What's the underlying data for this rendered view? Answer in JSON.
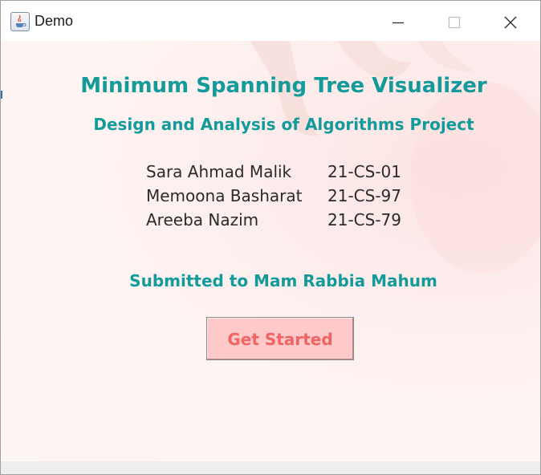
{
  "window": {
    "title": "Demo",
    "controls": [
      "minimize-icon",
      "maximize-icon",
      "close-icon"
    ]
  },
  "main": {
    "title": "Minimum Spanning Tree Visualizer",
    "subtitle": "Design and Analysis of Algorithms Project",
    "members": [
      {
        "name": "Sara Ahmad Malik",
        "id": "21-CS-01"
      },
      {
        "name": "Memoona Basharat",
        "id": "21-CS-97"
      },
      {
        "name": "Areeba Nazim",
        "id": "21-CS-79"
      }
    ],
    "submitted_to": "Submitted to Mam Rabbia Mahum",
    "start_button_label": "Get Started"
  },
  "colors": {
    "heading": "#139a9a",
    "button_bg": "#fdc9c9",
    "button_text": "#f06464",
    "background": "#fdeeee"
  }
}
